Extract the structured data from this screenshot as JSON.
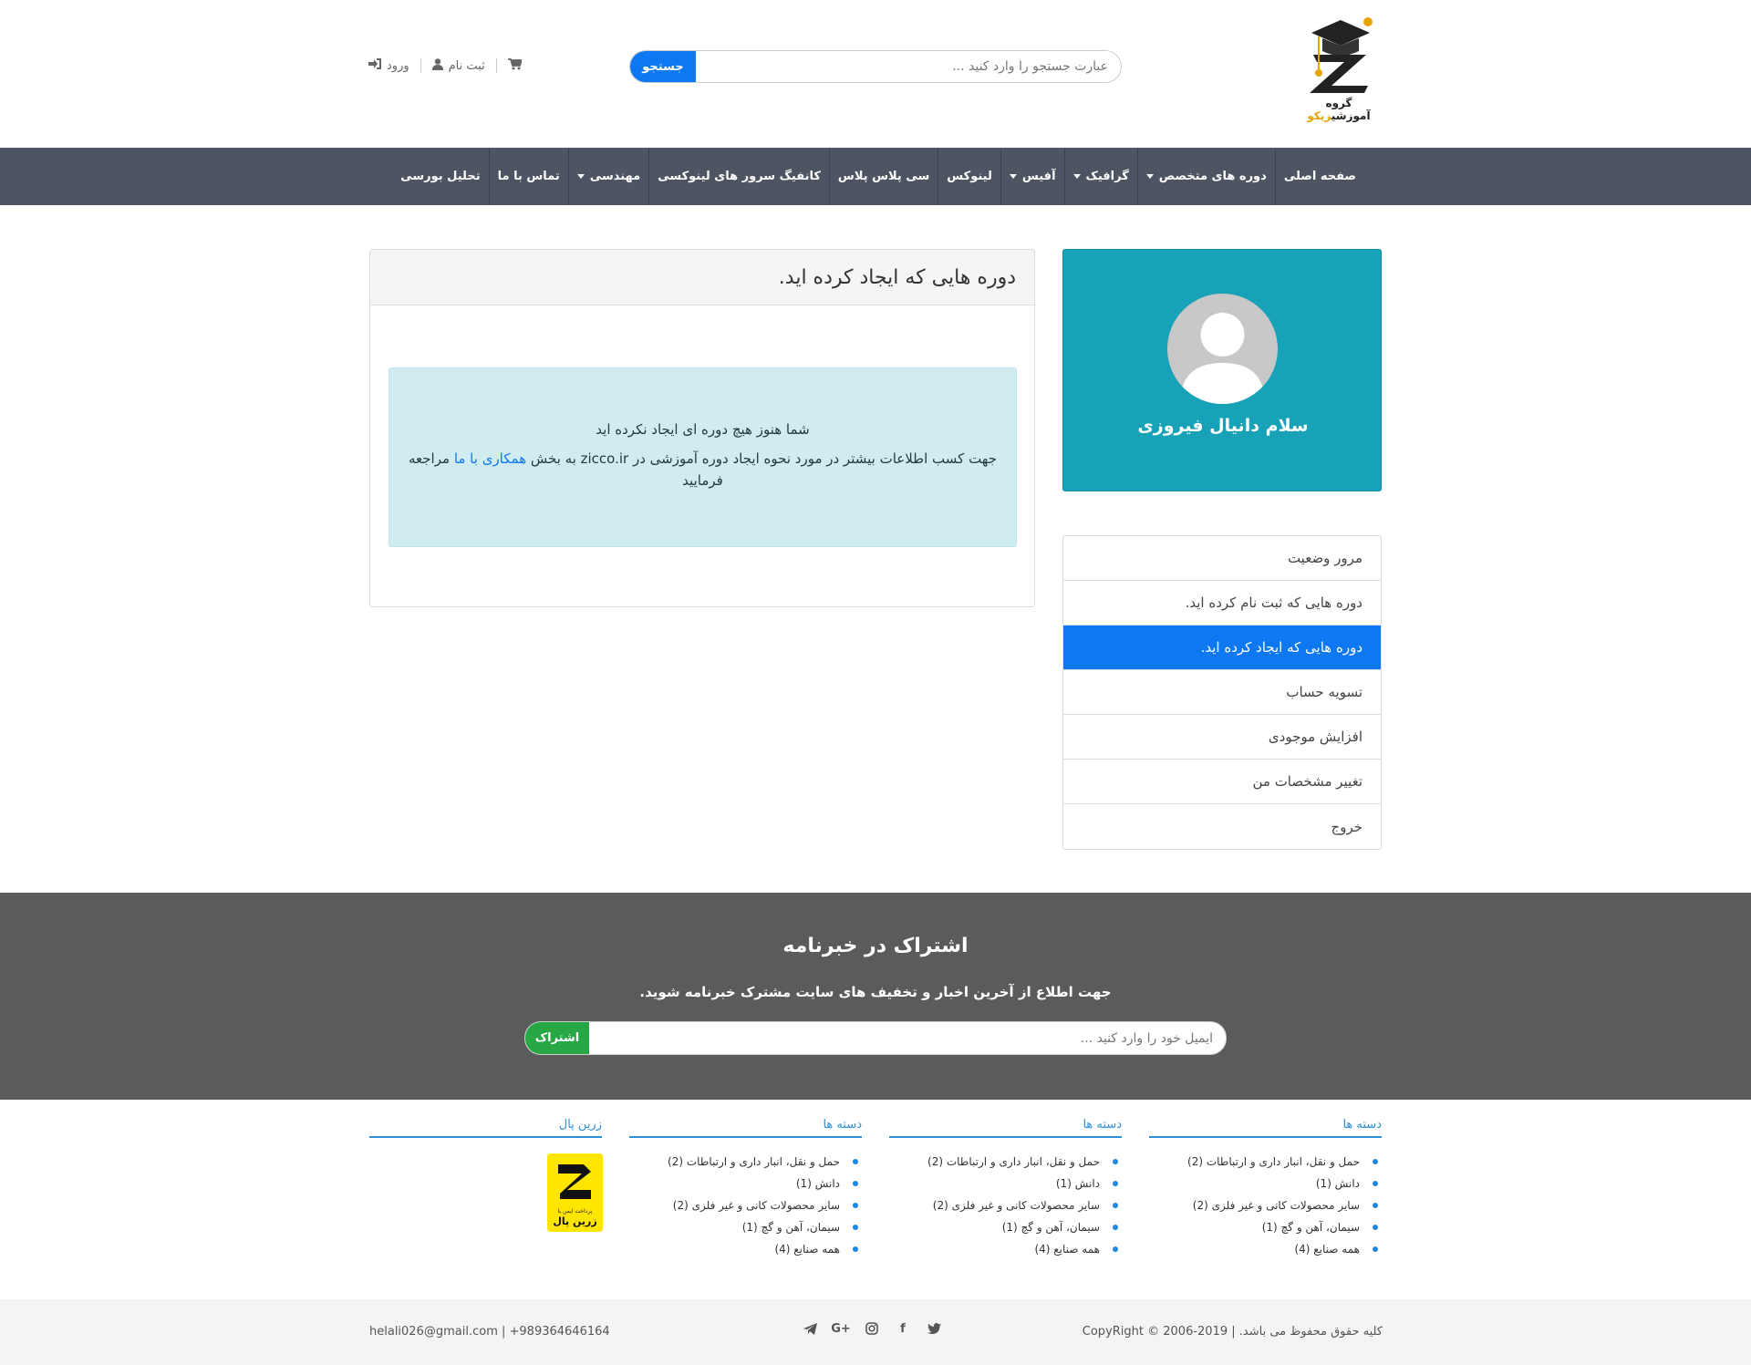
{
  "header": {
    "logo_text_dark": "گروه آموزشی",
    "logo_text_accent": "زیکو",
    "search_placeholder": "عبارت جستجو را وارد کنید ...",
    "search_button": "جستجو",
    "login": "ورود",
    "register": "ثبت نام",
    "icons": [
      "cart-icon",
      "user-icon",
      "login-icon"
    ]
  },
  "nav": {
    "items": [
      {
        "label": "صفحه اصلی",
        "dropdown": false
      },
      {
        "label": "دوره های متخصص",
        "dropdown": true
      },
      {
        "label": "گرافیک",
        "dropdown": true
      },
      {
        "label": "آفیس",
        "dropdown": true
      },
      {
        "label": "لینوکس",
        "dropdown": false
      },
      {
        "label": "سی پلاس پلاس",
        "dropdown": false
      },
      {
        "label": "کانفیگ سرور های لینوکسی",
        "dropdown": false
      },
      {
        "label": "مهندسی",
        "dropdown": true
      },
      {
        "label": "تماس با ما",
        "dropdown": false
      },
      {
        "label": "تحلیل بورسی",
        "dropdown": false
      }
    ]
  },
  "profile": {
    "greeting": "سلام دانیال فیروزی"
  },
  "side_menu": {
    "items": [
      {
        "label": "مرور وضعیت",
        "active": false
      },
      {
        "label": "دوره هایی که ثبت نام کرده اید.",
        "active": false
      },
      {
        "label": "دوره هایی که ایجاد کرده اید.",
        "active": true
      },
      {
        "label": "تسویه حساب",
        "active": false
      },
      {
        "label": "افزایش موجودی",
        "active": false
      },
      {
        "label": "تغییر مشخصات من",
        "active": false
      },
      {
        "label": "خروج",
        "active": false
      }
    ]
  },
  "main": {
    "title": "دوره هایی که ایجاد کرده اید.",
    "alert_line1": "شما هنوز هیچ دوره ای ایجاد نکرده اید",
    "alert_line2_a": "جهت کسب اطلاعات بیشتر در مورد نحوه ایجاد دوره آموزشی در zicco.ir به بخش",
    "alert_link": "همکاری با ما",
    "alert_line2_b": "مراجعه فرمایید"
  },
  "newsletter": {
    "title": "اشتراک در خبرنامه",
    "subtitle": "جهت اطلاع از آخرین اخبار و تخفیف های سایت مشترک خبرنامه شوید.",
    "placeholder": "ایمیل خود را وارد کنید ...",
    "button": "اشتراک"
  },
  "footer": {
    "columns": [
      {
        "title": "دسته ها",
        "items": [
          "حمل و نقل، انبار داری و ارتباطات (2)",
          "دانش (1)",
          "سایر محصولات کانی و غیر فلزی (2)",
          "سیمان، آهن و گچ (1)",
          "همه صنایع (4)"
        ]
      },
      {
        "title": "دسته ها",
        "items": [
          "حمل و نقل، انبار داری و ارتباطات (2)",
          "دانش (1)",
          "سایر محصولات کانی و غیر فلزی (2)",
          "سیمان، آهن و گچ (1)",
          "همه صنایع (4)"
        ]
      },
      {
        "title": "دسته ها",
        "items": [
          "حمل و نقل، انبار داری و ارتباطات (2)",
          "دانش (1)",
          "سایر محصولات کانی و غیر فلزی (2)",
          "سیمان، آهن و گچ (1)",
          "همه صنایع (4)"
        ]
      },
      {
        "title": "زرین پال",
        "items": []
      }
    ],
    "zarinpal_small": "پرداخت ایمن با",
    "zarinpal_big": "زرین پال",
    "copyright": "کلیه حقوق محفوظ می باشد. | CopyRight © 2006-2019",
    "email": "helali026@gmail.com",
    "phone": "+989364646164",
    "social_icons": [
      "telegram-icon",
      "google-plus-icon",
      "instagram-icon",
      "facebook-icon",
      "twitter-icon"
    ],
    "social_glyphs": {
      "gplus": "G+",
      "facebook": "f"
    }
  },
  "colors": {
    "navbar": "#4d5562",
    "primary": "#0d78f2",
    "profile": "#17a2b8",
    "newsletter": "#5b5b5b",
    "success": "#28a745"
  }
}
